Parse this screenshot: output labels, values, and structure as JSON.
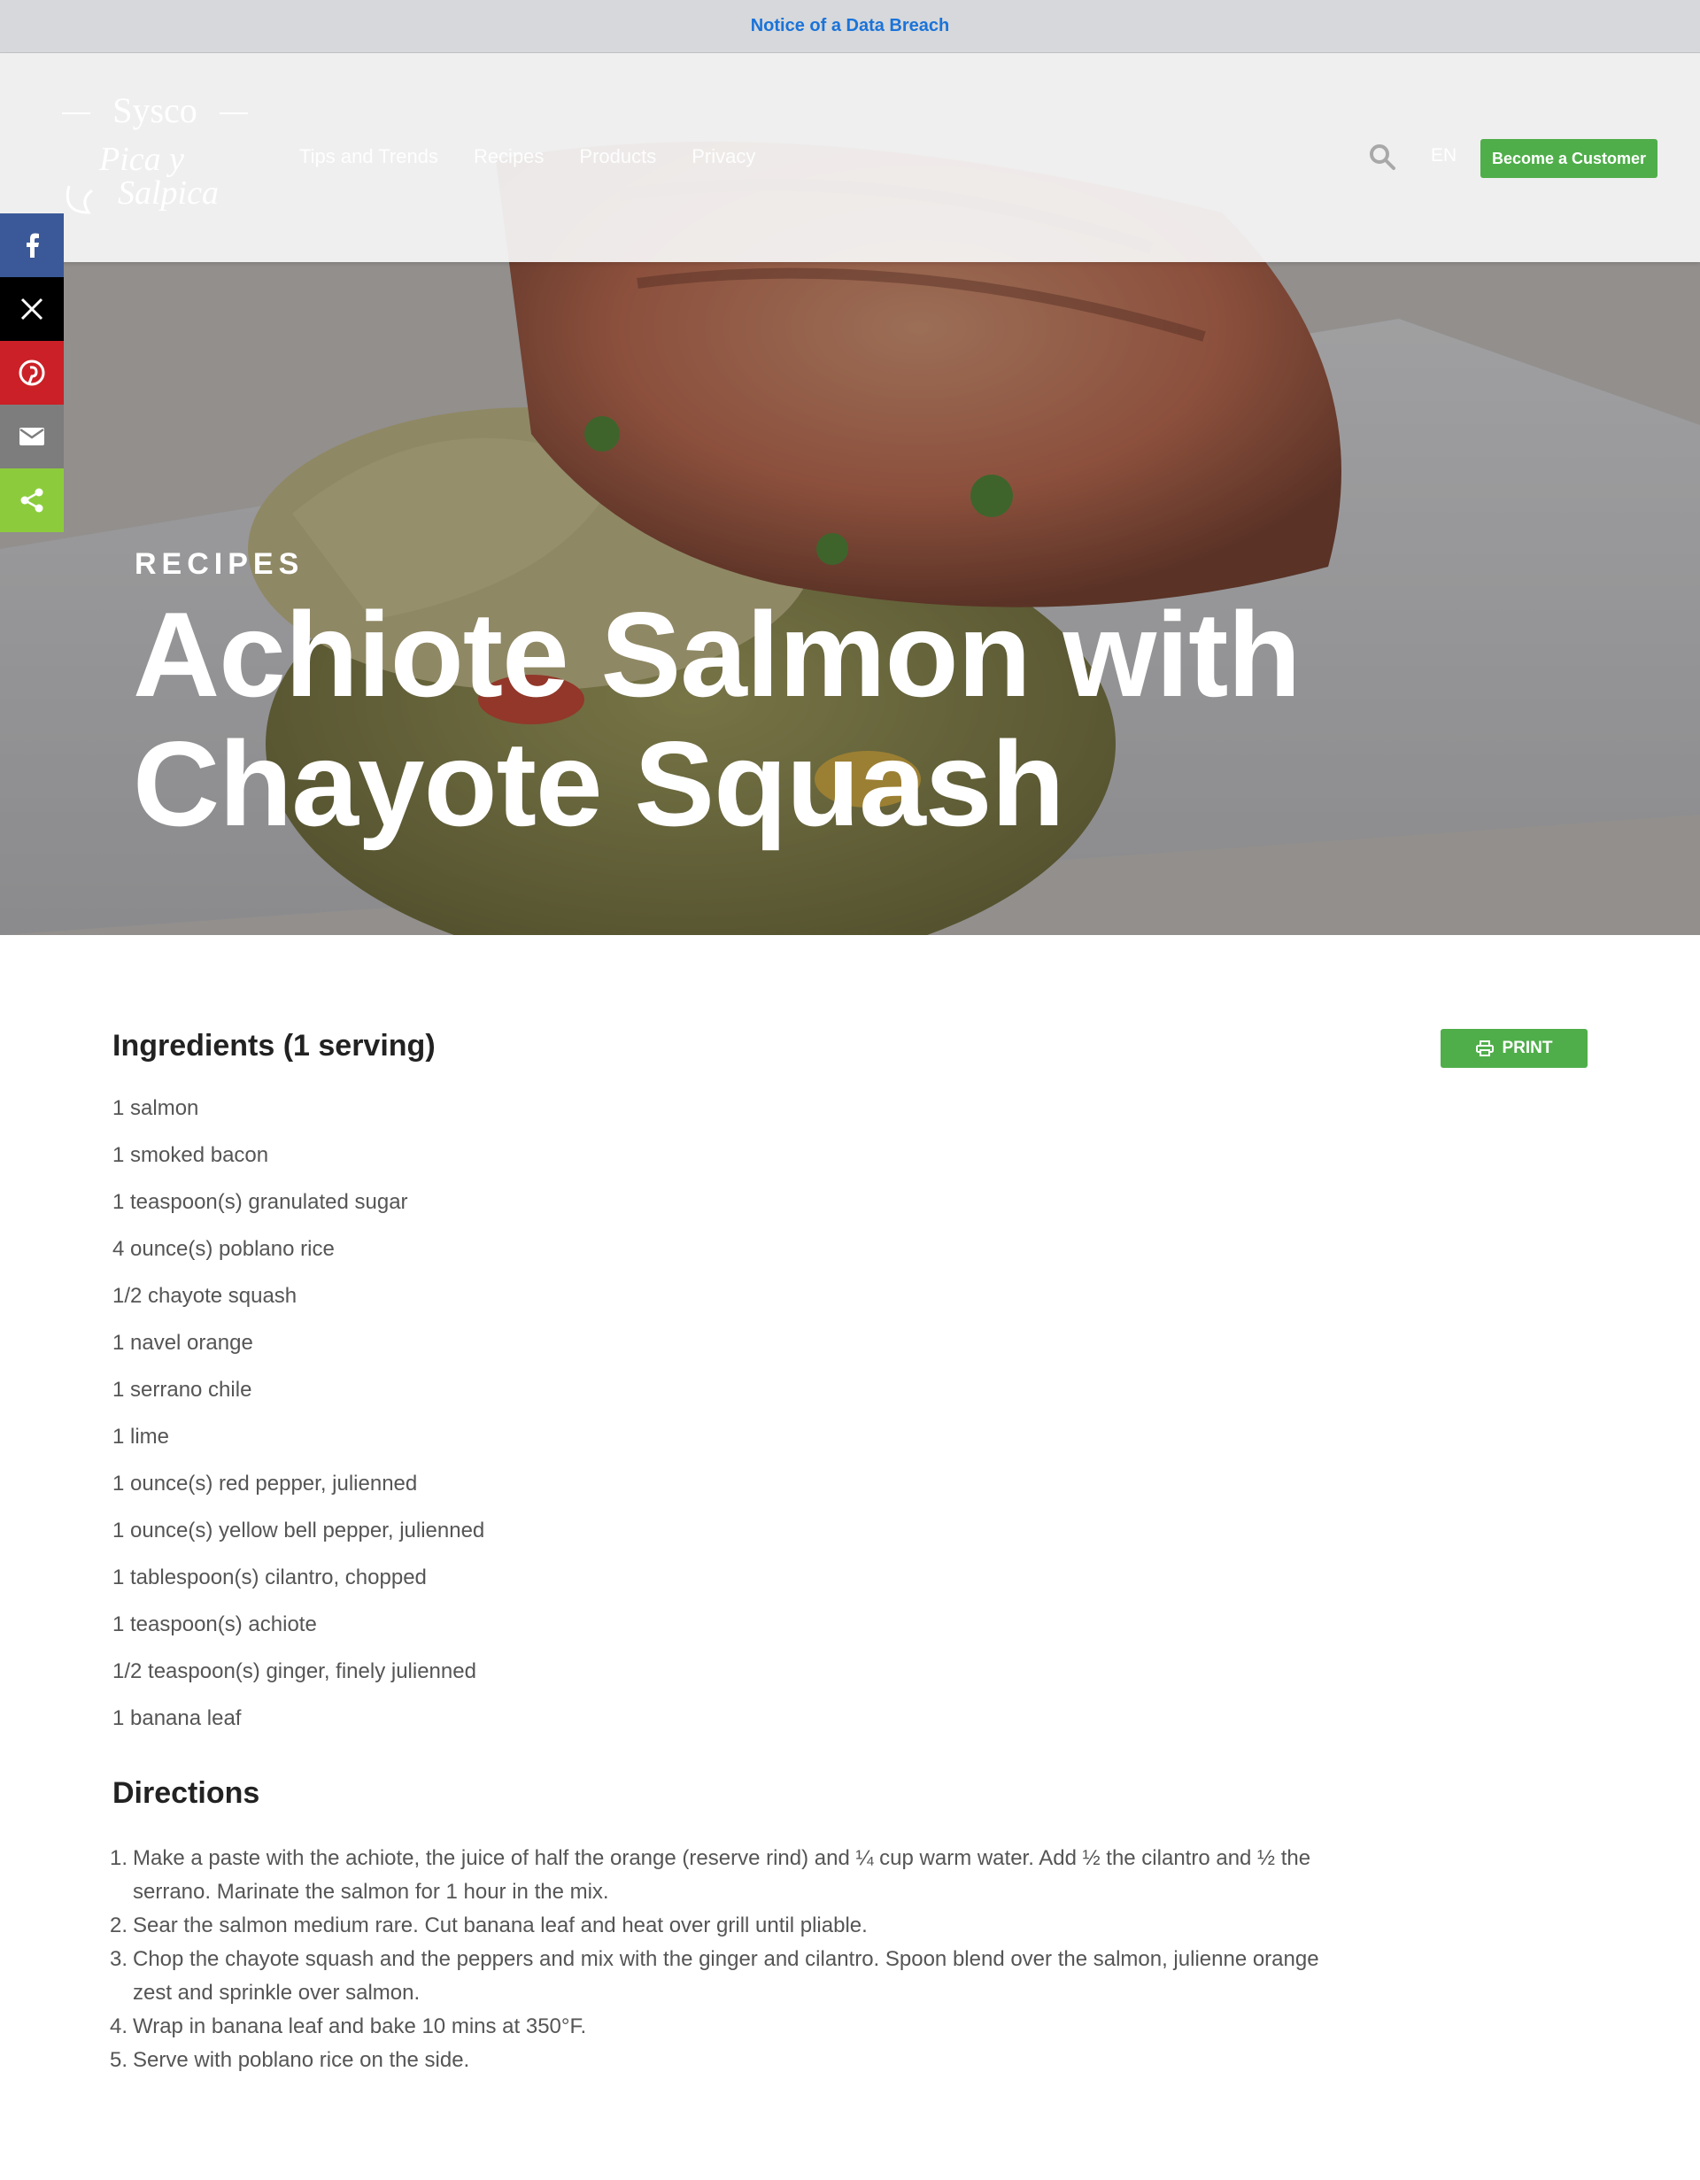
{
  "notice": {
    "link": "Notice of a Data Breach"
  },
  "header": {
    "logo": {
      "brand": "Sysco",
      "line1": "Pica y",
      "line2": "Salpica"
    },
    "nav": [
      "Tips and Trends",
      "Recipes",
      "Products",
      "Privacy"
    ],
    "search_icon": "search-icon",
    "language": "EN",
    "cta_label": "Become a Customer"
  },
  "share": {
    "items": [
      "facebook-icon",
      "x-icon",
      "pinterest-icon",
      "email-icon",
      "share-icon"
    ]
  },
  "hero": {
    "eyebrow": "RECIPES",
    "title": "Achiote Salmon with Chayote Squash"
  },
  "ingredients": {
    "heading": "Ingredients (1 serving)",
    "print_label": "PRINT",
    "items": [
      "1 salmon",
      "1 smoked bacon",
      "1 teaspoon(s) granulated sugar",
      "4 ounce(s) poblano rice",
      "1/2 chayote squash",
      "1 navel orange",
      "1 serrano chile",
      "1 lime",
      "1 ounce(s) red pepper, julienned",
      "1 ounce(s) yellow bell pepper, julienned",
      "1 tablespoon(s) cilantro, chopped",
      "1 teaspoon(s) achiote",
      "1/2 teaspoon(s) ginger, finely julienned",
      "1 banana leaf"
    ]
  },
  "directions": {
    "heading": "Directions",
    "steps": [
      "Make a paste with the achiote, the juice of half the orange (reserve rind) and ¼ cup warm water. Add ½ the cilantro and ½ the serrano. Marinate the salmon for 1 hour in the mix.",
      "Sear the salmon medium rare. Cut banana leaf and heat over grill until pliable.",
      "Chop the chayote squash and the peppers and mix with the ginger and cilantro. Spoon blend over the salmon, julienne orange zest and sprinkle over salmon.",
      "Wrap in banana leaf and bake 10 mins at 350°F.",
      "Serve with poblano rice on the side."
    ]
  },
  "colors": {
    "accent_green": "#4fae4a",
    "notice_link": "#1a73d9",
    "facebook": "#3b5998",
    "pinterest": "#cb2027",
    "share": "#8ccc3c"
  }
}
